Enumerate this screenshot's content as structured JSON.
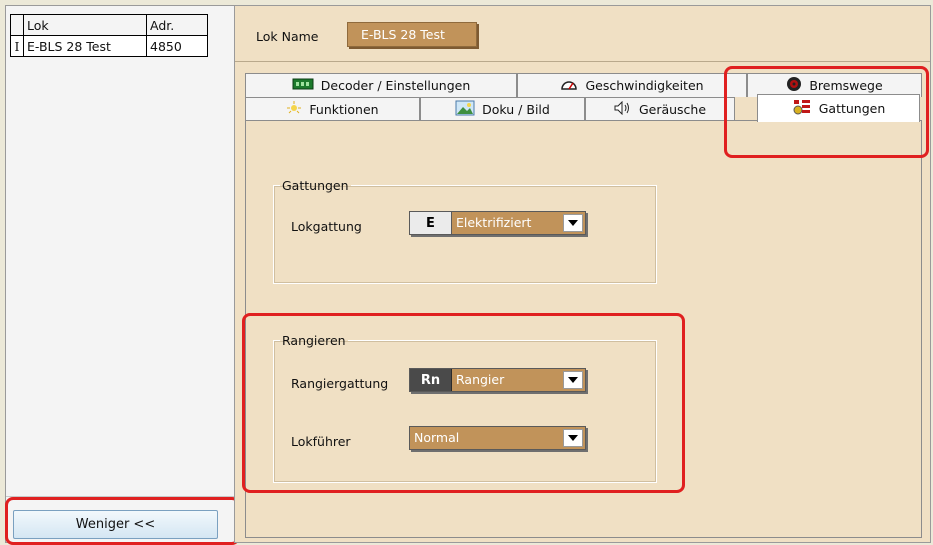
{
  "loco_list": {
    "headers": [
      "Lok",
      "Adr."
    ],
    "rows": [
      {
        "marker": "I",
        "name": "E-BLS 28  Test",
        "address": "4850"
      }
    ]
  },
  "less_button": "Weniger <<",
  "lok_name": {
    "label": "Lok Name",
    "value": "E-BLS 28  Test"
  },
  "tabs": {
    "decoder": "Decoder / Einstellungen",
    "speed": "Geschwindigkeiten",
    "brake": "Bremswege",
    "functions": "Funktionen",
    "docs": "Doku / Bild",
    "sounds": "Geräusche",
    "classes": "Gattungen"
  },
  "gattungen_group": {
    "legend": "Gattungen",
    "lokgattung": {
      "label": "Lokgattung",
      "code": "E",
      "value": "Elektrifiziert"
    }
  },
  "rangieren_group": {
    "legend": "Rangieren",
    "rangiergattung": {
      "label": "Rangiergattung",
      "code": "Rn",
      "value": "Rangier"
    },
    "lokfuehrer": {
      "label": "Lokführer",
      "value": "Normal"
    }
  },
  "colors": {
    "accent": "#c1935a",
    "panel": "#f0e0c4",
    "highlight": "#e02020"
  }
}
